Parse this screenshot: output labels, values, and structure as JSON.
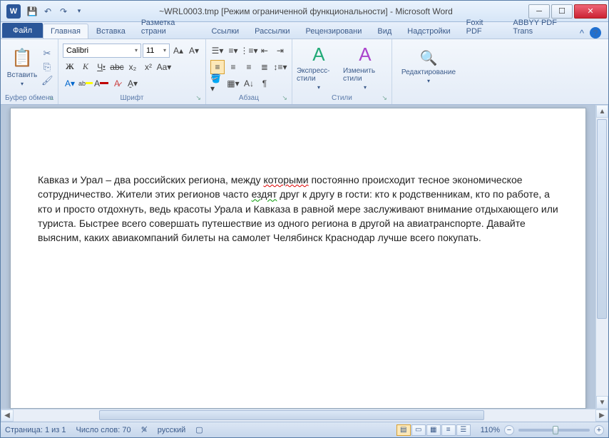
{
  "title": "~WRL0003.tmp  [Режим ограниченной функциональности]  -  Microsoft Word",
  "qat_word_letter": "W",
  "tabs": {
    "file": "Файл",
    "items": [
      "Главная",
      "Вставка",
      "Разметка страни",
      "Ссылки",
      "Рассылки",
      "Рецензировани",
      "Вид",
      "Надстройки",
      "Foxit PDF",
      "ABBYY PDF Trans"
    ]
  },
  "ribbon": {
    "clipboard": {
      "label": "Буфер обмена",
      "paste": "Вставить"
    },
    "font": {
      "label": "Шрифт",
      "name": "Calibri",
      "size": "11"
    },
    "paragraph": {
      "label": "Абзац"
    },
    "styles": {
      "label": "Стили",
      "quick": "Экспресс-стили",
      "change": "Изменить стили"
    },
    "editing": {
      "label": "Редактирование"
    }
  },
  "document": {
    "p1_a": "Кавказ и Урал – два российских региона, между ",
    "p1_wavy1": "которыми",
    "p1_b": "  постоянно происходит тесное экономическое сотрудничество. Жители этих регионов часто ",
    "p1_wavy2": "ездят",
    "p1_c": " друг к другу в гости: кто к родственникам, кто по работе, а кто и просто отдохнуть, ведь красоты Урала и Кавказа в равной мере заслуживают внимание отдыхающего или туриста. Быстрее всего совершать путешествие из одного региона в другой на авиатранспорте. Давайте выясним, каких авиакомпаний билеты на самолет Челябинск Краснодар лучше всего покупать."
  },
  "status": {
    "page": "Страница: 1 из 1",
    "words": "Число слов: 70",
    "lang": "русский",
    "zoom": "110%"
  }
}
